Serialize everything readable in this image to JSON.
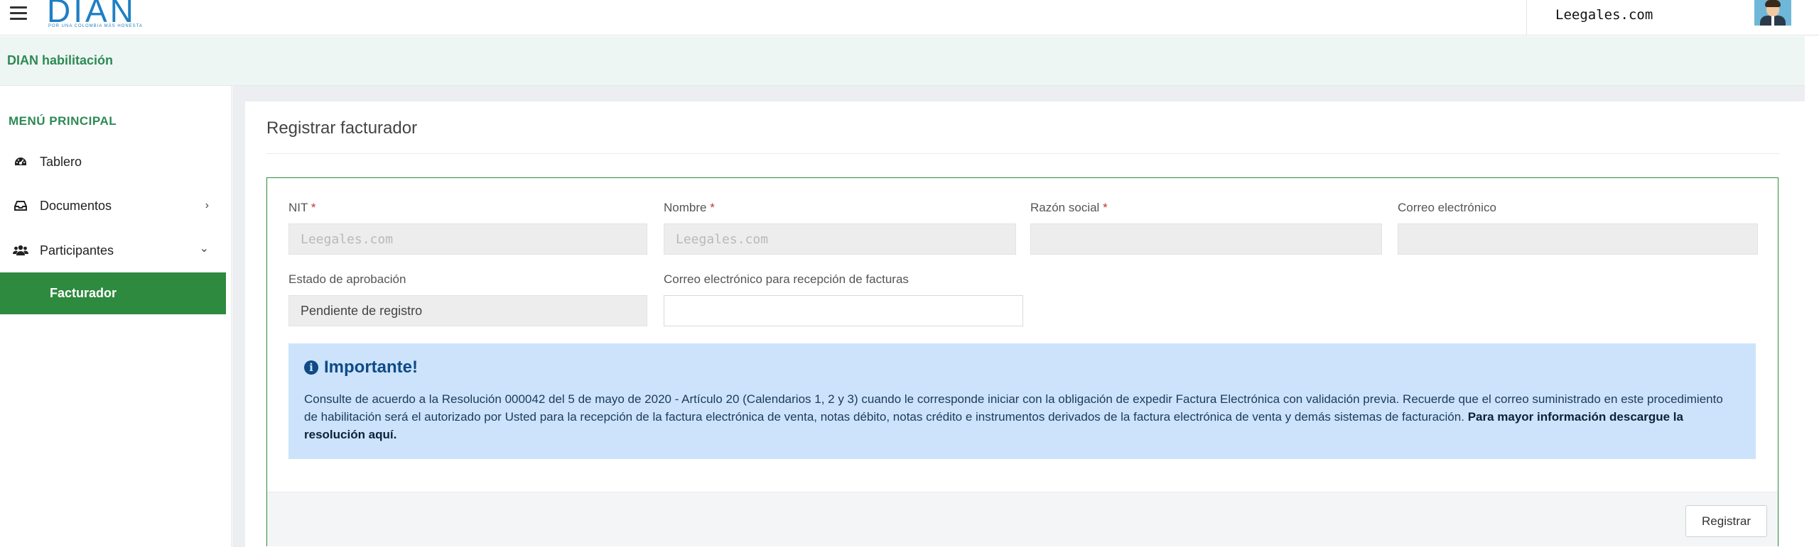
{
  "topbar": {
    "logo_text": "DIAN",
    "logo_tagline": "POR UNA COLOMBIA MÁS HONESTA",
    "user_name": "Leegales.com"
  },
  "subheader": {
    "title": "DIAN habilitación"
  },
  "sidebar": {
    "menu_title": "MENÚ PRINCIPAL",
    "items": [
      {
        "label": "Tablero",
        "icon": "dashboard-icon"
      },
      {
        "label": "Documentos",
        "icon": "inbox-icon",
        "chevron": "›"
      },
      {
        "label": "Participantes",
        "icon": "users-icon",
        "chevron": "⌄"
      }
    ],
    "active_subitem": "Facturador"
  },
  "main": {
    "title": "Registrar facturador",
    "fields": {
      "nit": {
        "label": "NIT",
        "required": "*",
        "value": "Leegales.com"
      },
      "nombre": {
        "label": "Nombre",
        "required": "*",
        "value": "Leegales.com"
      },
      "razon_social": {
        "label": "Razón social",
        "required": "*",
        "value": ""
      },
      "correo": {
        "label": "Correo electrónico",
        "value": ""
      },
      "estado": {
        "label": "Estado de aprobación",
        "value": "Pendiente de registro"
      },
      "correo_facturas": {
        "label": "Correo electrónico para recepción de facturas",
        "value": ""
      }
    },
    "info": {
      "title": "Importante!",
      "text": "Consulte de acuerdo a la Resolución 000042 del 5 de mayo de 2020 - Artículo 20 (Calendarios 1, 2 y 3) cuando le corresponde iniciar con la obligación de expedir Factura Electrónica con validación previa. Recuerde que el correo suministrado en este procedimiento de habilitación será el autorizado por Usted para la recepción de la factura electrónica de venta, notas débito, notas crédito e instrumentos derivados de la factura electrónica de venta y demás sistemas de facturación.",
      "bold_text": "Para mayor información descargue la resolución aquí."
    },
    "submit_label": "Registrar"
  }
}
